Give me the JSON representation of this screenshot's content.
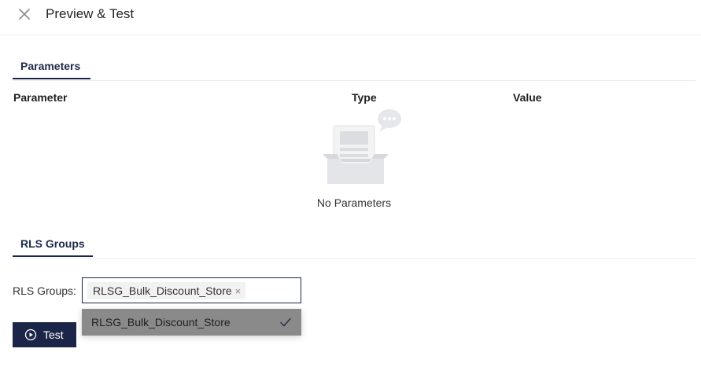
{
  "header": {
    "title": "Preview & Test",
    "close_icon": "close-icon"
  },
  "parameters_section": {
    "tab_label": "Parameters",
    "columns": [
      "Parameter",
      "Type",
      "Value"
    ],
    "empty_text": "No Parameters",
    "empty_icon": "empty-inbox-icon"
  },
  "rls_section": {
    "tab_label": "RLS Groups",
    "field_label": "RLS Groups:",
    "selected_chip": "RLSG_Bulk_Discount_Store",
    "chip_remove_glyph": "×",
    "dropdown_options": [
      {
        "label": "RLSG_Bulk_Discount_Store",
        "selected": true
      }
    ]
  },
  "actions": {
    "test_label": "Test",
    "test_icon": "play-circle-icon"
  },
  "colors": {
    "accent": "#1b2548",
    "divider": "#ececec",
    "dropdown_highlight": "#8a8a8a"
  }
}
